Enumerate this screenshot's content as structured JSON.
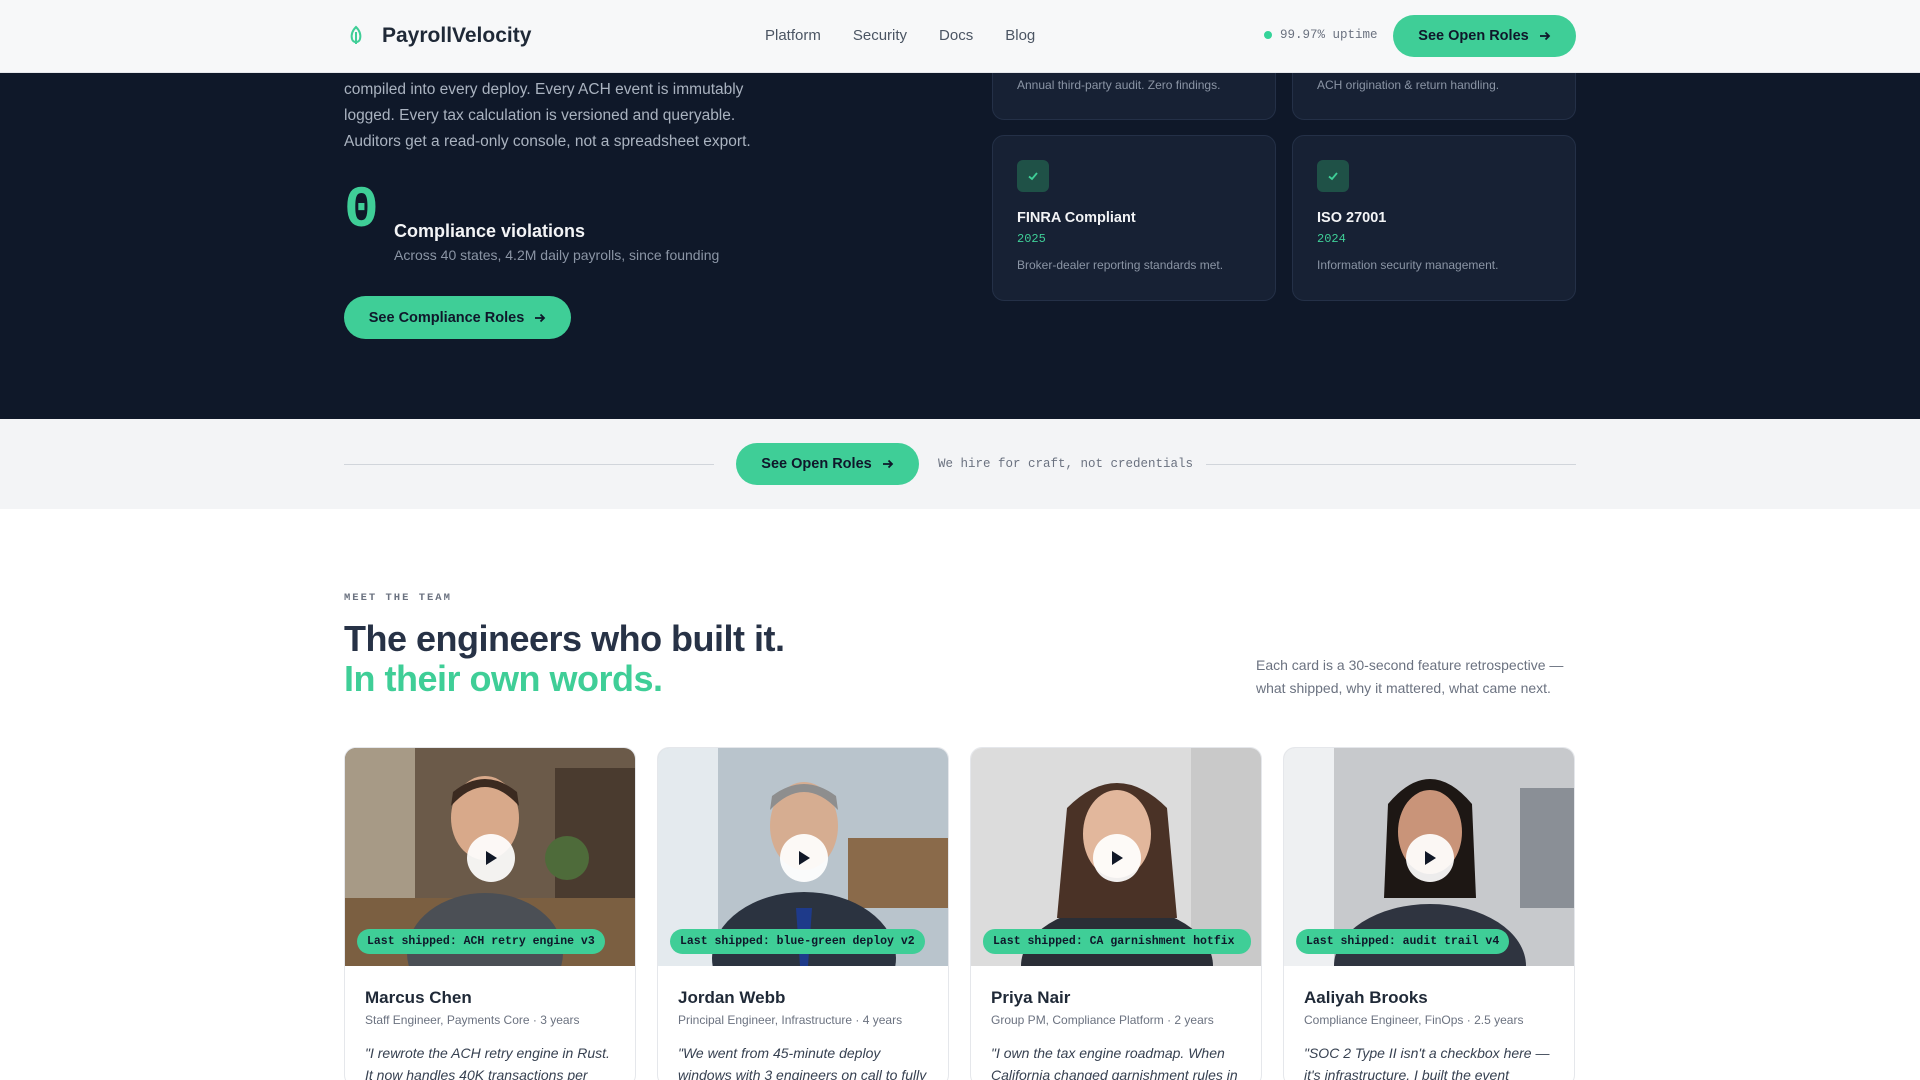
{
  "nav": {
    "brand": "PayrollVelocity",
    "links": [
      "Platform",
      "Security",
      "Docs",
      "Blog"
    ],
    "uptime": "99.97% uptime",
    "cta": "See Open Roles"
  },
  "compliance": {
    "intro": "compiled into every deploy. Every ACH event is immutably logged. Every tax calculation is versioned and queryable. Auditors get a read-only console, not a spreadsheet export.",
    "stat_value": "0",
    "stat_title": "Compliance violations",
    "stat_sub": "Across 40 states, 4.2M daily payrolls, since founding",
    "button": "See Compliance Roles",
    "certs_top": [
      {
        "desc": "Annual third-party audit. Zero findings."
      },
      {
        "desc": "ACH origination & return handling."
      }
    ],
    "certs": [
      {
        "name": "FINRA Compliant",
        "year": "2025",
        "desc": "Broker-dealer reporting standards met."
      },
      {
        "name": "ISO 27001",
        "year": "2024",
        "desc": "Information security management."
      }
    ]
  },
  "band": {
    "button": "See Open Roles",
    "text": "We hire for craft, not credentials"
  },
  "team": {
    "eyebrow": "MEET THE TEAM",
    "title_line1": "The engineers who built it.",
    "title_line2": "In their own words.",
    "note": "Each card is a 30-second feature retrospective — what shipped, why it mattered, what came next.",
    "members": [
      {
        "name": "Marcus Chen",
        "role": "Staff Engineer, Payments Core · 3 years",
        "shipped": "Last shipped: ACH retry engine v3",
        "quote": "\"I rewrote the ACH retry engine in Rust. It now handles 40K transactions per"
      },
      {
        "name": "Jordan Webb",
        "role": "Principal Engineer, Infrastructure · 4 years",
        "shipped": "Last shipped: blue-green deploy v2",
        "quote": "\"We went from 45-minute deploy windows with 3 engineers on call to fully"
      },
      {
        "name": "Priya Nair",
        "role": "Group PM, Compliance Platform · 2 years",
        "shipped": "Last shipped: CA garnishment hotfix",
        "quote": "\"I own the tax engine roadmap. When California changed garnishment rules in"
      },
      {
        "name": "Aaliyah Brooks",
        "role": "Compliance Engineer, FinOps · 2.5 years",
        "shipped": "Last shipped: audit trail v4",
        "quote": "\"SOC 2 Type II isn't a checkbox here — it's infrastructure. I built the event"
      }
    ]
  },
  "colors": {
    "accent": "#3fce97",
    "dark_bg": "#0f1829",
    "card_bg": "#172134"
  },
  "icons": [
    "leaf-logo-icon",
    "arrow-right-icon",
    "check-icon",
    "play-icon",
    "status-dot-icon"
  ]
}
